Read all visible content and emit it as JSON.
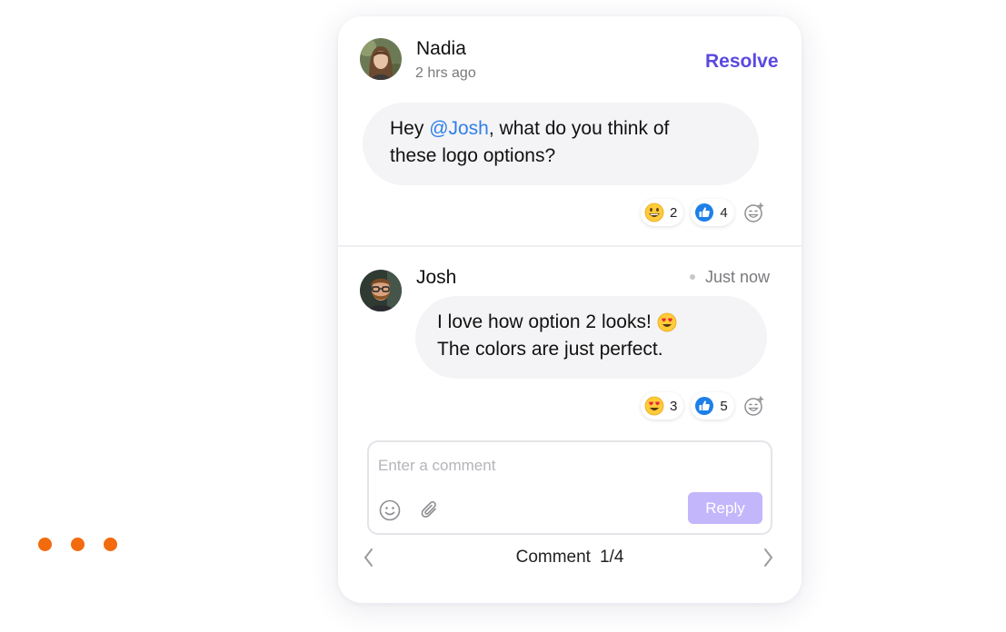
{
  "thread": {
    "resolve_label": "Resolve",
    "comments": [
      {
        "author": "Nadia",
        "time": "2 hrs ago",
        "message_prefix": "Hey ",
        "mention": "@Josh",
        "message_suffix_line1": ", what do you think of",
        "message_line2": "these logo options?",
        "reactions": [
          {
            "emoji": "grinning-face",
            "count": "2"
          },
          {
            "emoji": "thumbs-up",
            "count": "4"
          }
        ]
      },
      {
        "author": "Josh",
        "time": "Just now",
        "message_line1": "I love how option 2 looks!",
        "message_line1_emoji": "heart-eyes-face",
        "message_line2": "The colors are just perfect.",
        "reactions": [
          {
            "emoji": "heart-eyes-face",
            "count": "3"
          },
          {
            "emoji": "thumbs-up",
            "count": "5"
          }
        ]
      }
    ]
  },
  "composer": {
    "placeholder": "Enter a comment",
    "reply_label": "Reply"
  },
  "pager": {
    "label": "Comment",
    "position": "1/4"
  },
  "colors": {
    "accent": "#5b48e0",
    "mention": "#2f7fe8",
    "reply_button": "#c3b6fb",
    "decor_dots": "#f26b0f"
  }
}
